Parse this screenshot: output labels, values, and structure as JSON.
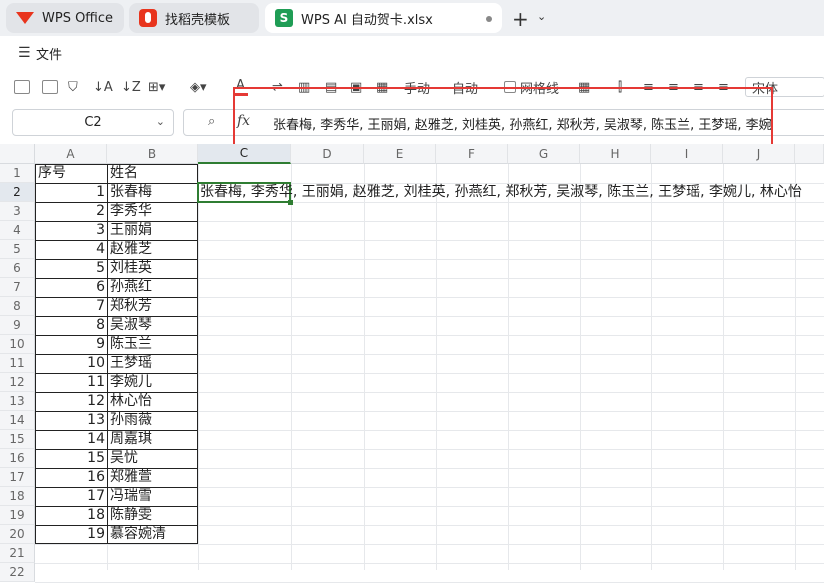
{
  "tabs": [
    {
      "label": "WPS Office",
      "icon": "wps-logo-icon"
    },
    {
      "label": "找稻壳模板",
      "icon": "docer-icon"
    },
    {
      "label": "WPS AI 自动贺卡.xlsx",
      "icon": "spreadsheet-s-icon",
      "badge": "S"
    }
  ],
  "menu": {
    "file_label": "文件"
  },
  "toolbar": {
    "auto1": "手动",
    "auto2": "自动",
    "gridlines": "网格线",
    "font": "宋体"
  },
  "formula_bar": {
    "cell_ref": "C2",
    "fx_label": "fx",
    "content": "张春梅, 李秀华, 王丽娟, 赵雅芝, 刘桂英, 孙燕红, 郑秋芳, 吴淑琴, 陈玉兰, 王梦瑶, 李婉"
  },
  "columns": [
    "A",
    "B",
    "C",
    "D",
    "E",
    "F",
    "G",
    "H",
    "I",
    "J"
  ],
  "rows": [
    "1",
    "2",
    "3",
    "4",
    "5",
    "6",
    "7",
    "8",
    "9",
    "10",
    "11",
    "12",
    "13",
    "14",
    "15",
    "16",
    "17",
    "18",
    "19",
    "20",
    "21",
    "22"
  ],
  "sheet": {
    "header_a": "序号",
    "header_b": "姓名",
    "numbers": [
      "1",
      "2",
      "3",
      "4",
      "5",
      "6",
      "7",
      "8",
      "9",
      "10",
      "11",
      "12",
      "13",
      "14",
      "15",
      "16",
      "17",
      "18",
      "19"
    ],
    "names": [
      "张春梅",
      "李秀华",
      "王丽娟",
      "赵雅芝",
      "刘桂英",
      "孙燕红",
      "郑秋芳",
      "吴淑琴",
      "陈玉兰",
      "王梦瑶",
      "李婉儿",
      "林心怡",
      "孙雨薇",
      "周嘉琪",
      "吴忧",
      "郑雅萱",
      "冯瑞雪",
      "陈静雯",
      "慕容婉清"
    ],
    "c2": "张春梅, 李秀华, 王丽娟, 赵雅芝, 刘桂英, 孙燕红, 郑秋芳, 吴淑琴, 陈玉兰, 王梦瑶, 李婉儿, 林心怡"
  },
  "colors": {
    "accent": "#2f7d32",
    "highlight_box": "#e53935",
    "wps_red": "#e8341d"
  }
}
